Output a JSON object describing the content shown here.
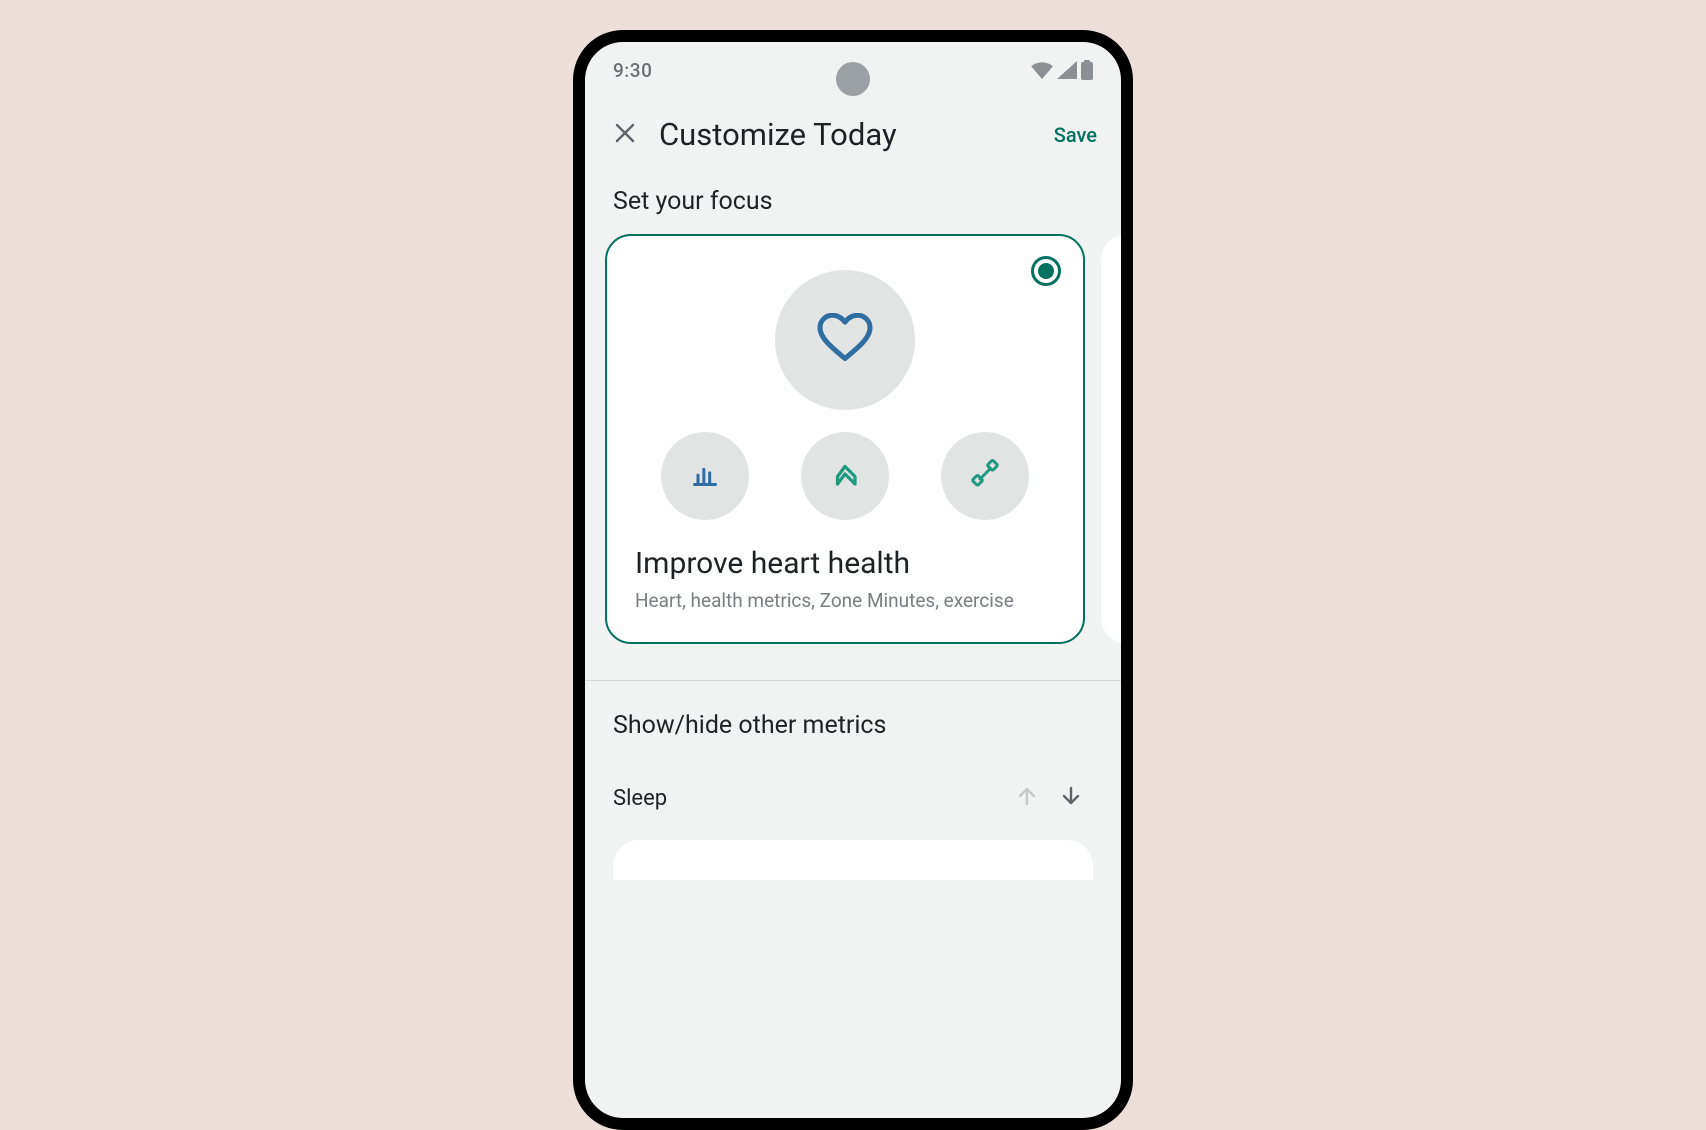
{
  "status": {
    "time": "9:30"
  },
  "header": {
    "title": "Customize Today",
    "save_label": "Save"
  },
  "sections": {
    "focus_label": "Set your focus",
    "metrics_label": "Show/hide other metrics"
  },
  "focus_card": {
    "title": "Improve heart health",
    "subtitle": "Heart, health metrics, Zone Minutes, exercise",
    "selected": true,
    "icons": {
      "main": "heart-icon",
      "small": [
        "bar-chart-icon",
        "arrow-up-icon",
        "dumbbell-icon"
      ]
    }
  },
  "metrics": [
    {
      "name": "Sleep",
      "up_enabled": false,
      "down_enabled": true
    }
  ],
  "colors": {
    "accent": "#00725f",
    "heart_stroke": "#2f6ea3"
  }
}
